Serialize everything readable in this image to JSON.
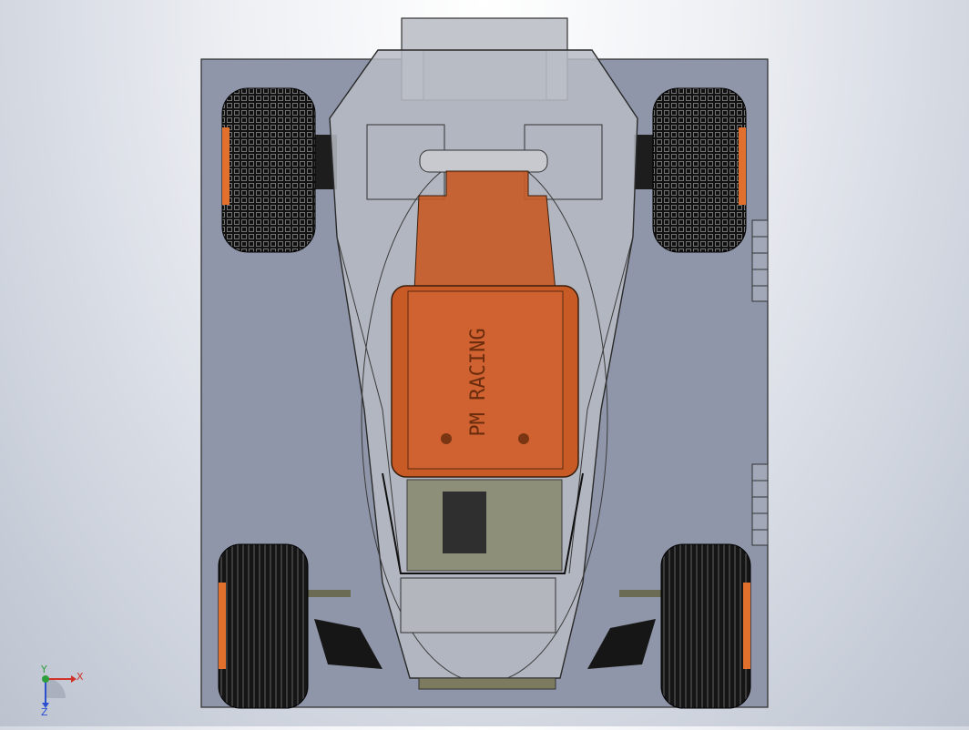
{
  "viewport": {
    "background_top": "#ffffff",
    "background_bottom": "#bcc3cf"
  },
  "colors": {
    "plate": "#8f96a9",
    "body_shell": "#b9bcc4",
    "chassis_orange": "#c85a26",
    "tire": "#1b1b1b",
    "rim_orange": "#e0702c",
    "lower_tray": "#8e8f78",
    "axis_x": "#d0322a",
    "axis_y": "#2c9e3a",
    "axis_z": "#2b4fcf"
  },
  "chassis_text": "PM RACING",
  "triad": {
    "x_label": "X",
    "y_label": "Y",
    "z_label": "Z"
  }
}
